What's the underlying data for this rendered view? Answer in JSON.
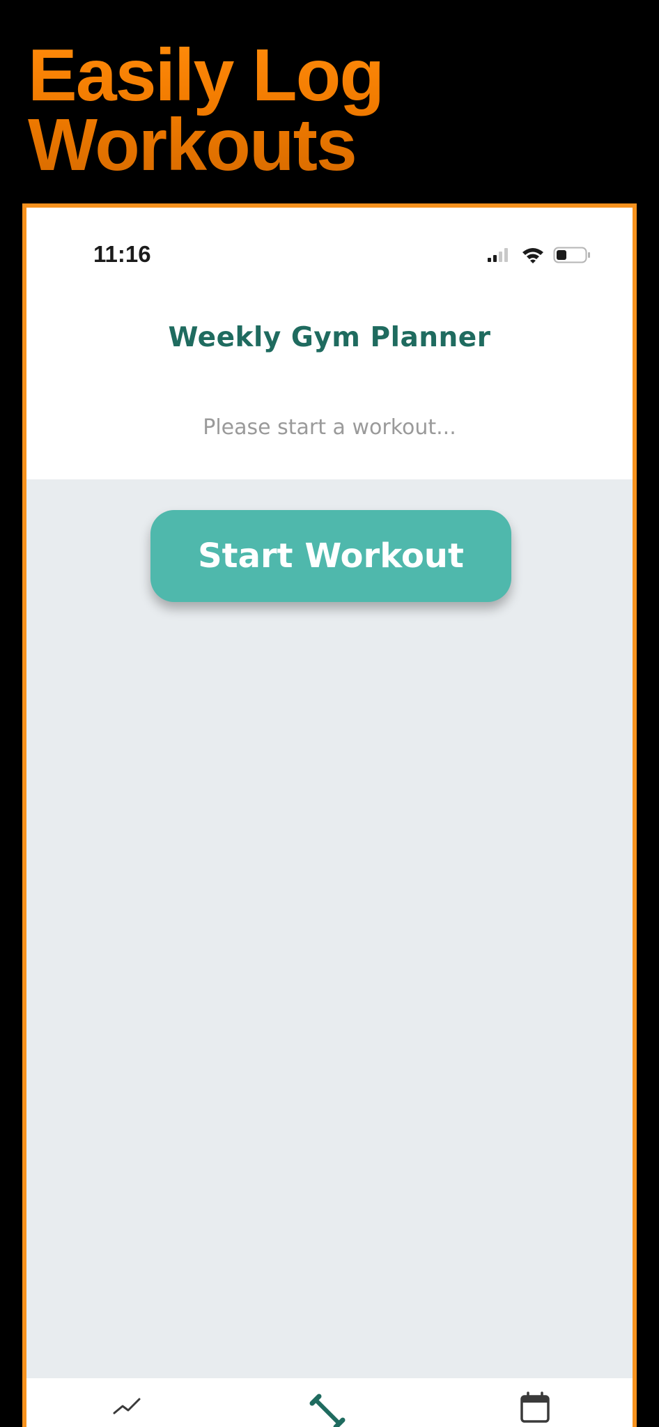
{
  "promo": {
    "title_line1": "Easily Log",
    "title_line2": "Workouts",
    "accent_color": "#f7921e"
  },
  "status_bar": {
    "time": "11:16",
    "icons": [
      "cellular-signal-icon",
      "wifi-icon",
      "battery-icon"
    ]
  },
  "app": {
    "title": "Weekly Gym Planner",
    "subtitle": "Please start a workout...",
    "start_button_label": "Start Workout",
    "primary_color": "#4fb8ac",
    "title_color": "#1f6b5f",
    "background_color": "#e8ecef"
  },
  "tab_bar": {
    "items": [
      {
        "icon": "chart-line-icon",
        "active": false
      },
      {
        "icon": "dumbbell-icon",
        "active": true
      },
      {
        "icon": "calendar-icon",
        "active": false
      }
    ]
  }
}
